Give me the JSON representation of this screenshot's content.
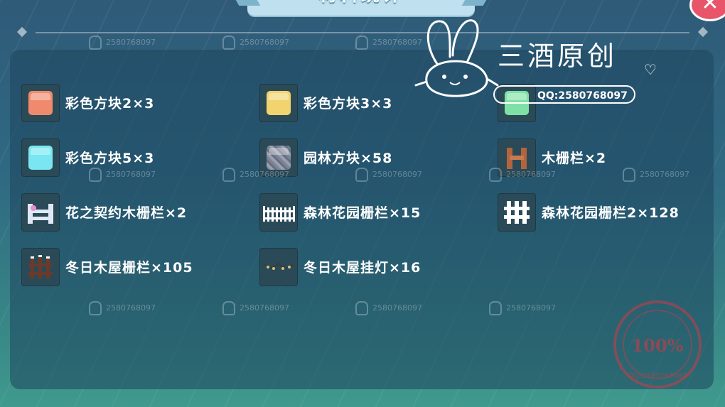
{
  "header": {
    "title": "材料统计",
    "close_glyph": "✕"
  },
  "items": [
    {
      "label": "彩色方块2×3",
      "icon": "orange-cube-icon",
      "color": "#f08a6c"
    },
    {
      "label": "彩色方块3×3",
      "icon": "yellow-cube-icon",
      "color": "#f2d46e"
    },
    {
      "label": "",
      "icon": "green-cube-icon",
      "color": "#7fe0a6"
    },
    {
      "label": "彩色方块5×3",
      "icon": "cyan-cube-icon",
      "color": "#79e6f2"
    },
    {
      "label": "园林方块×58",
      "icon": "garden-block-icon",
      "color": "#8a8fa0"
    },
    {
      "label": "木栅栏×2",
      "icon": "wood-fence-icon",
      "color": "#b3643c"
    },
    {
      "label": "花之契约木栅栏×2",
      "icon": "flower-fence-icon",
      "color": "#dfe9f5"
    },
    {
      "label": "森林花园栅栏×15",
      "icon": "forest-garden-fence-icon",
      "color": "#ffffff"
    },
    {
      "label": "森林花园栅栏2×128",
      "icon": "forest-garden-fence-2-icon",
      "color": "#ffffff"
    },
    {
      "label": "冬日木屋栅栏×105",
      "icon": "winter-cabin-fence-icon",
      "color": "#6b3a2a"
    },
    {
      "label": "冬日木屋挂灯×16",
      "icon": "winter-cabin-lights-icon",
      "color": "#d6c27a"
    }
  ],
  "watermark": {
    "text": "2580768097"
  },
  "overlay": {
    "brand": "三酒原创",
    "qq_tag": "QQ:2580768097",
    "stamp_percent": "100%",
    "stamp_text": "QQ:2580768097"
  }
}
